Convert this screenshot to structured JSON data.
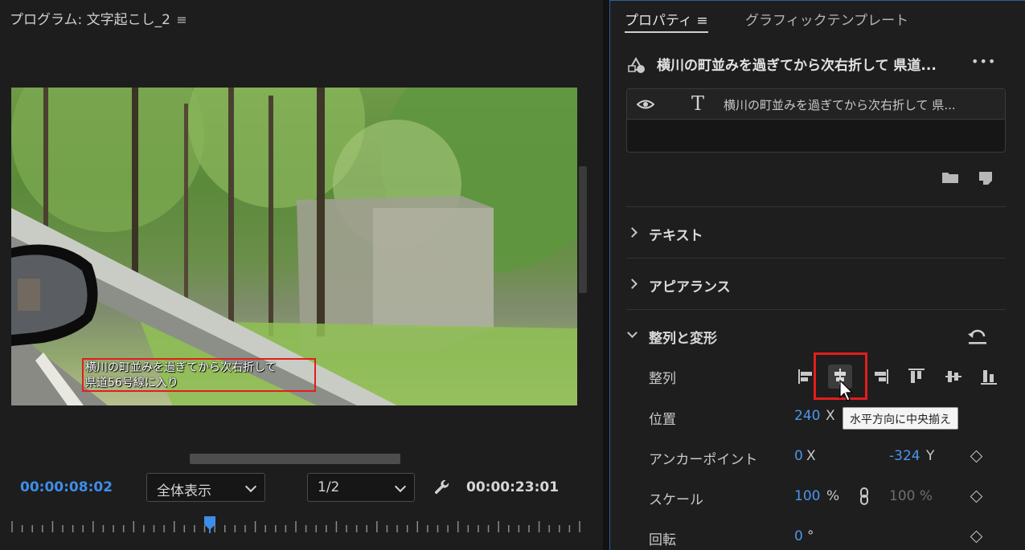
{
  "program_monitor": {
    "title": "プログラム: 文字起こし_2",
    "menu_icon": "≡",
    "caption_lines": [
      "横川の町並みを過ぎてから次右折して",
      "県道56号線に入り"
    ],
    "current_timecode": "00:00:08:02",
    "fit_select": "全体表示",
    "resolution_select": "1/2",
    "duration_timecode": "00:00:23:01",
    "playhead_fraction": 0.35
  },
  "properties_panel": {
    "tabs": [
      {
        "label": "プロパティ ≡",
        "active": true
      },
      {
        "label": "グラフィックテンプレート",
        "active": false
      }
    ],
    "layer_title": "横川の町並みを過ぎてから次右折して 県道...",
    "more_icon": "•••",
    "layer_item": {
      "icon": "T",
      "name": "横川の町並みを過ぎてから次右折して 県..."
    },
    "sections": {
      "text": "テキスト",
      "appearance": "アピアランス",
      "align_transform": "整列と変形"
    },
    "properties": {
      "align_label": "整列",
      "position_label": "位置",
      "position_x": "240",
      "position_x_unit": "X",
      "anchor_label": "アンカーポイント",
      "anchor_x": "0",
      "anchor_x_unit": "X",
      "anchor_y": "-324",
      "anchor_y_unit": "Y",
      "scale_label": "スケール",
      "scale_value": "100",
      "scale_unit": "%",
      "scale_value2": "100 %",
      "rotation_label": "回転",
      "rotation_value": "0",
      "rotation_unit": "°"
    },
    "tooltip": "水平方向に中央揃え"
  },
  "colors": {
    "accent_blue": "#4a95ec",
    "highlight_red": "#e21d1d",
    "panel_bg": "#1e1e1e"
  }
}
